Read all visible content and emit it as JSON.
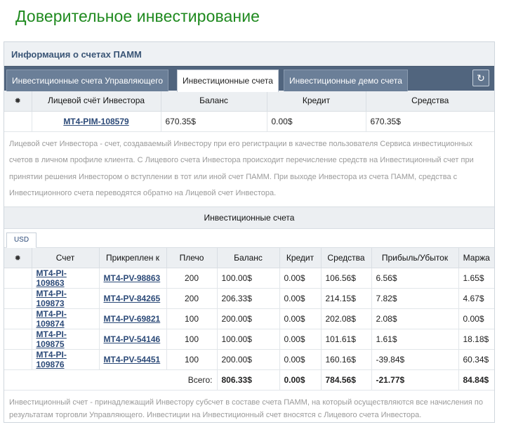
{
  "page": {
    "title": "Доверительное инвестирование"
  },
  "panel": {
    "title": "Информация о счетах ПАММ",
    "tabs": [
      {
        "label": "Инвестиционные счета Управляющего",
        "active": false
      },
      {
        "label": "Инвестиционные счета",
        "active": true
      },
      {
        "label": "Инвестиционные демо счета",
        "active": false
      }
    ],
    "refresh_icon": "refresh-icon"
  },
  "personal": {
    "headers": [
      "Лицевой счёт Инвестора",
      "Баланс",
      "Кредит",
      "Средства"
    ],
    "row": {
      "account": "MT4-PIM-108579",
      "balance": "670.35$",
      "credit": "0.00$",
      "funds": "670.35$"
    },
    "note": "Лицевой счет Инвестора - счет, создаваемый Инвестору при его регистрации в качестве пользователя Сервиса инвестиционных счетов в личном профиле клиента. С Лицевого счета Инвестора происходит перечисление средств на Инвестиционный счет при принятии решения Инвестором о вступлении в тот или иной счет ПАММ. При выходе Инвестора из счета ПАММ, средства с Инвестиционного счета переводятся обратно на Лицевой счет Инвестора."
  },
  "investment": {
    "section_title": "Инвестиционные счета",
    "currency_tab": "USD",
    "headers": [
      "Счет",
      "Прикреплен к",
      "Плечо",
      "Баланс",
      "Кредит",
      "Средства",
      "Прибыль/Убыток",
      "Маржа"
    ],
    "rows": [
      {
        "account": "MT4-PI-109863",
        "attached": "MT4-PV-98863",
        "leverage": "200",
        "balance": "100.00$",
        "credit": "0.00$",
        "funds": "106.56$",
        "pnl": "6.56$",
        "margin": "1.65$"
      },
      {
        "account": "MT4-PI-109873",
        "attached": "MT4-PV-84265",
        "leverage": "200",
        "balance": "206.33$",
        "credit": "0.00$",
        "funds": "214.15$",
        "pnl": "7.82$",
        "margin": "4.67$"
      },
      {
        "account": "MT4-PI-109874",
        "attached": "MT4-PV-69821",
        "leverage": "100",
        "balance": "200.00$",
        "credit": "0.00$",
        "funds": "202.08$",
        "pnl": "2.08$",
        "margin": "0.00$"
      },
      {
        "account": "MT4-PI-109875",
        "attached": "MT4-PV-54146",
        "leverage": "100",
        "balance": "100.00$",
        "credit": "0.00$",
        "funds": "101.61$",
        "pnl": "1.61$",
        "margin": "18.18$"
      },
      {
        "account": "MT4-PI-109876",
        "attached": "MT4-PV-54451",
        "leverage": "100",
        "balance": "200.00$",
        "credit": "0.00$",
        "funds": "160.16$",
        "pnl": "-39.84$",
        "margin": "60.34$"
      }
    ],
    "totals": {
      "label": "Всего:",
      "balance": "806.33$",
      "credit": "0.00$",
      "funds": "784.56$",
      "pnl": "-21.77$",
      "margin": "84.84$"
    },
    "note": "Инвестиционный счет - принадлежащий Инвестору субсчет в составе счета ПАММ, на который осуществляются все начисления по результатам торговли Управляющего. Инвестиции на Инвестиционный счет вносятся с Лицевого счета Инвестора."
  }
}
